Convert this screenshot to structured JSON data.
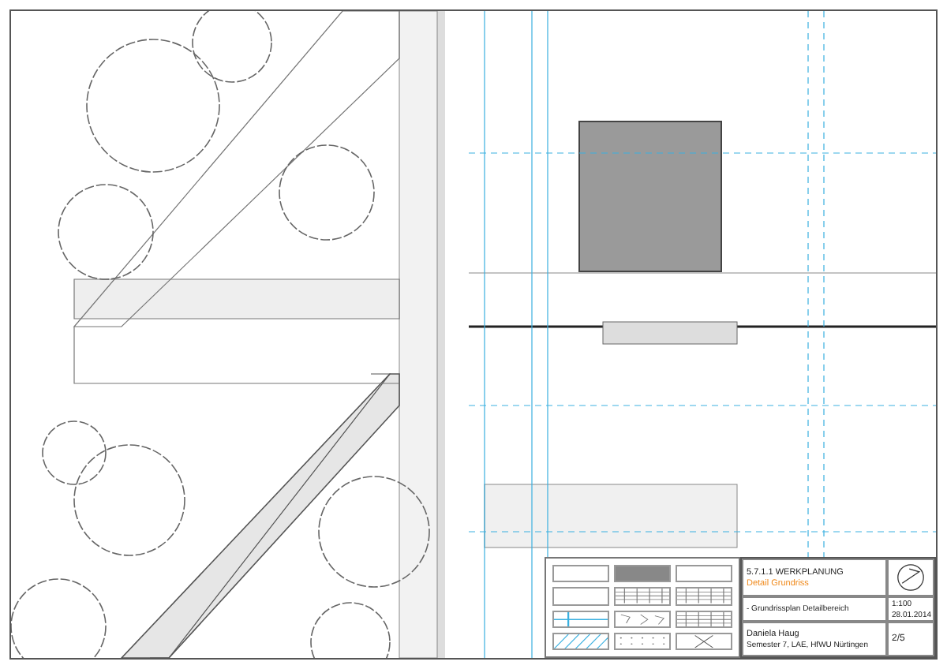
{
  "legend": {
    "items": [
      {
        "kind": "blank"
      },
      {
        "kind": "dense"
      },
      {
        "kind": "blank"
      },
      {
        "kind": "blank"
      },
      {
        "kind": "brick"
      },
      {
        "kind": "brick"
      },
      {
        "kind": "pipe"
      },
      {
        "kind": "stones"
      },
      {
        "kind": "brick"
      },
      {
        "kind": "hatch"
      },
      {
        "kind": "dots"
      },
      {
        "kind": "cross"
      }
    ]
  },
  "title_block": {
    "title": "5.7.1.1 WERKPLANUNG",
    "subtitle": "Detail Grundriss",
    "plan_name": "- Grundrissplan Detailbereich",
    "scale": "1:100",
    "date": "28.01.2014",
    "author": "Daniela Haug",
    "course": "Semester 7, LAE, HfWU Nürtingen",
    "sheet": "2/5"
  }
}
